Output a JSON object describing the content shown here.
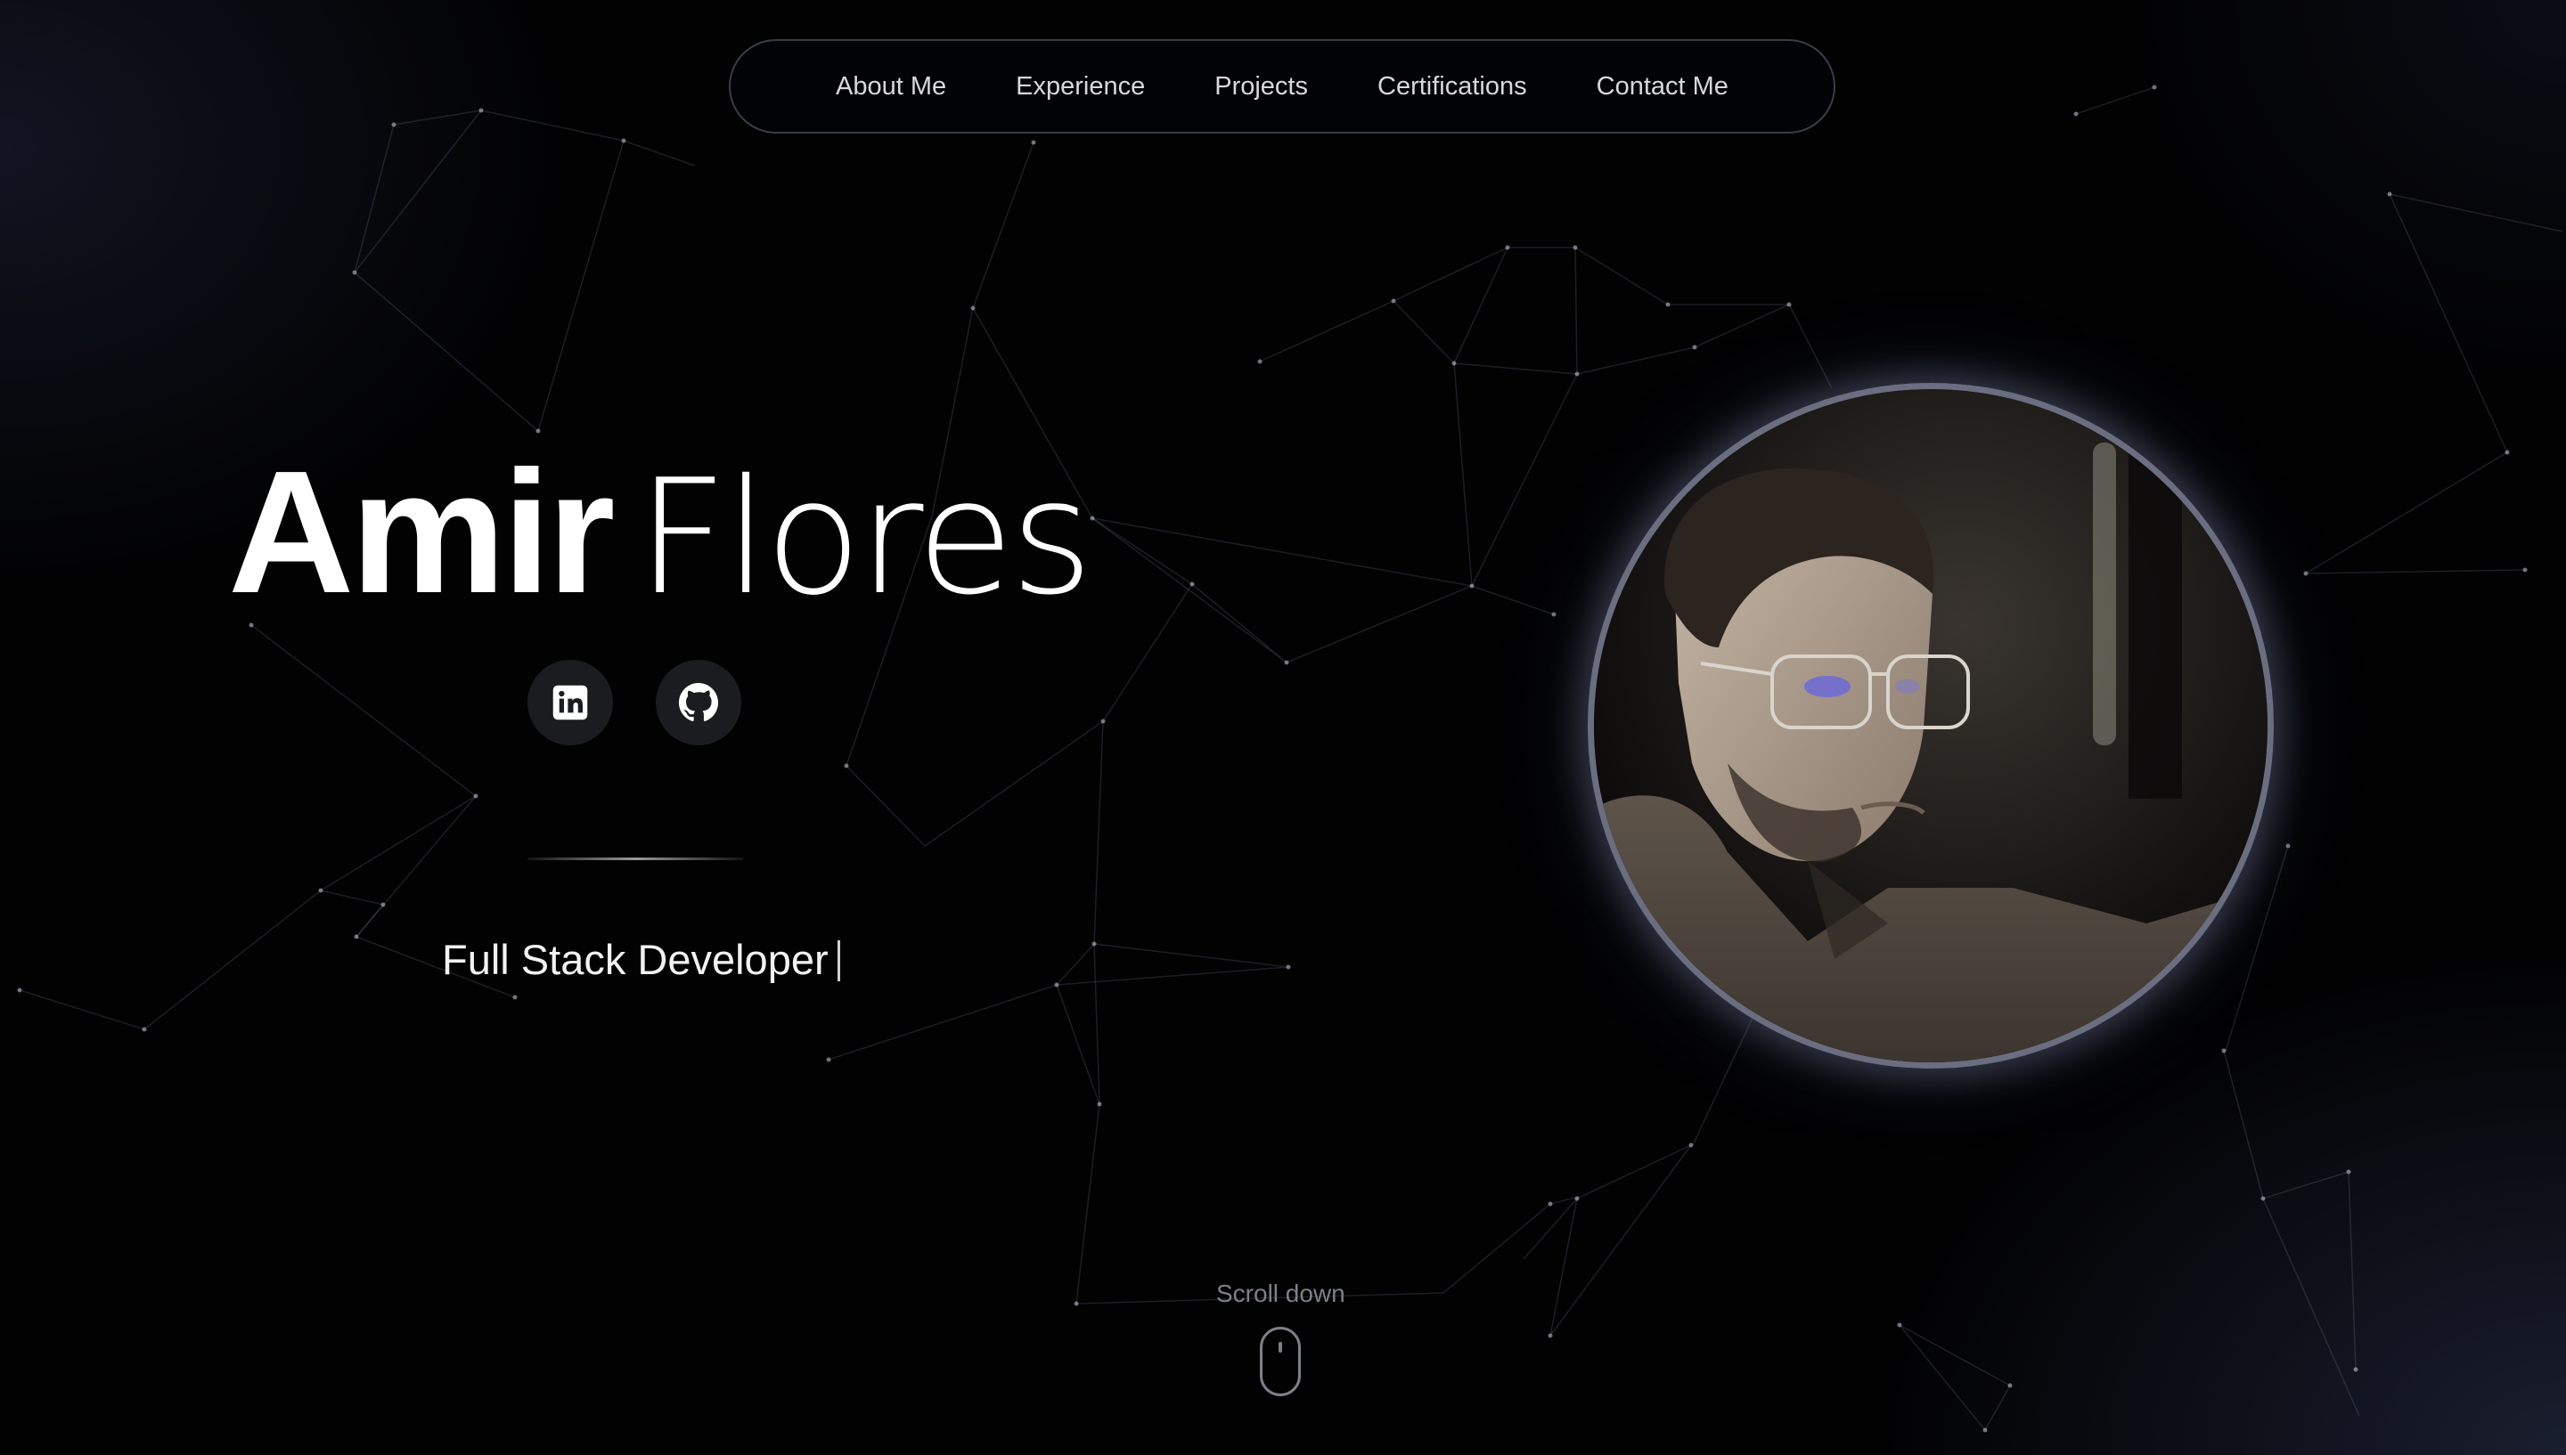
{
  "nav": {
    "items": [
      {
        "label": "About Me"
      },
      {
        "label": "Experience"
      },
      {
        "label": "Projects"
      },
      {
        "label": "Certifications"
      },
      {
        "label": "Contact Me"
      }
    ]
  },
  "hero": {
    "first_name": "Amir",
    "last_name": "Flores",
    "role": "Full Stack Developer",
    "social": [
      {
        "icon": "linkedin-icon"
      },
      {
        "icon": "github-icon"
      }
    ]
  },
  "scroll": {
    "label": "Scroll down"
  },
  "colors": {
    "background": "#020203",
    "nav_border": "#3a3d46",
    "avatar_ring": "#6a6e80",
    "muted_text": "#7d8088"
  }
}
